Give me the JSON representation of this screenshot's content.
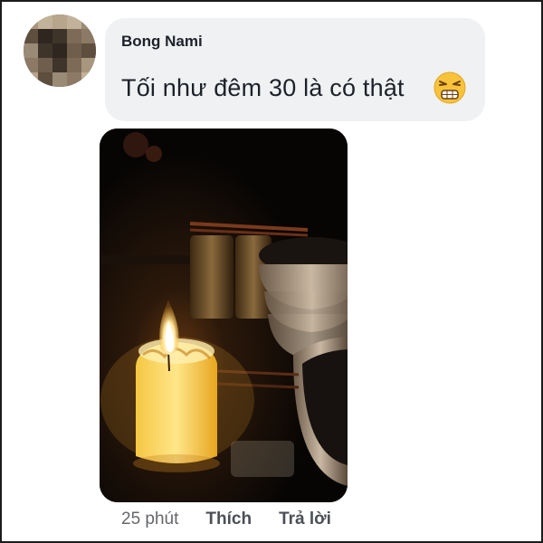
{
  "comment": {
    "author": "Bong Nami",
    "text": "Tối như đêm 30 là có thật",
    "emoji_icon": "persevering-face-emoji",
    "timestamp": "25 phút",
    "like_label": "Thích",
    "reply_label": "Trả lời"
  },
  "colors": {
    "bubble_bg": "#f0f1f3",
    "text": "#1d2129",
    "meta_text": "#65676b"
  }
}
